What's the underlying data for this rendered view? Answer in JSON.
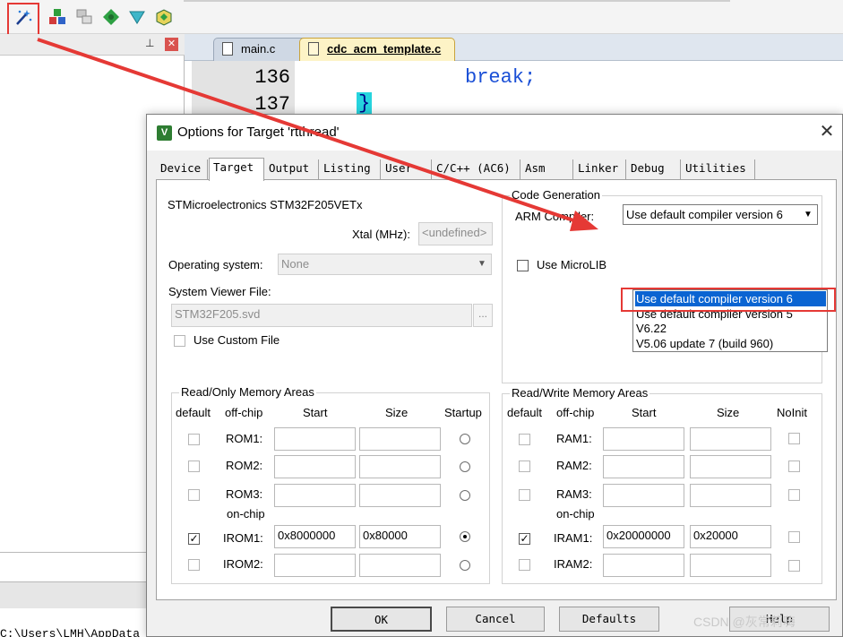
{
  "ide": {
    "editor_tabs": [
      {
        "label": "main.c",
        "active": false
      },
      {
        "label": "cdc_acm_template.c",
        "active": true
      }
    ],
    "line_numbers": [
      "136",
      "137"
    ],
    "code_line_136": "break;",
    "code_line_137": "}",
    "bottom_path": "C:\\Users\\LMH\\AppData"
  },
  "dialog": {
    "title": "Options for Target 'rtthread'",
    "tabs": [
      "Device",
      "Target",
      "Output",
      "Listing",
      "User",
      "C/C++ (AC6)",
      "Asm",
      "Linker",
      "Debug",
      "Utilities"
    ],
    "active_tab": "Target",
    "device_name": "STMicroelectronics STM32F205VETx",
    "xtal_label": "Xtal (MHz):",
    "xtal_value": "<undefined>",
    "os_label": "Operating system:",
    "os_value": "None",
    "svd_label": "System Viewer File:",
    "svd_value": "STM32F205.svd",
    "svd_browse": "...",
    "use_custom_file": "Use Custom File",
    "code_generation": {
      "title": "Code Generation",
      "arm_compiler_label": "ARM Compiler:",
      "arm_compiler_value": "Use default compiler version 6",
      "use_microlib": "Use MicroLIB",
      "options": [
        "Use default compiler version 6",
        "Use default compiler version 5",
        "V6.22",
        "V5.06 update 7 (build 960)"
      ],
      "selected_index": 0
    },
    "ro_memory": {
      "title": "Read/Only Memory Areas",
      "headers": {
        "default": "default",
        "offchip": "off-chip",
        "start": "Start",
        "size": "Size",
        "extra": "Startup"
      },
      "offchip_rows": [
        {
          "label": "ROM1:",
          "start": "",
          "size": "",
          "default_checked": false,
          "startup_selected": false
        },
        {
          "label": "ROM2:",
          "start": "",
          "size": "",
          "default_checked": false,
          "startup_selected": false
        },
        {
          "label": "ROM3:",
          "start": "",
          "size": "",
          "default_checked": false,
          "startup_selected": false
        }
      ],
      "onchip_label": "on-chip",
      "onchip_rows": [
        {
          "label": "IROM1:",
          "start": "0x8000000",
          "size": "0x80000",
          "default_checked": true,
          "startup_selected": true
        },
        {
          "label": "IROM2:",
          "start": "",
          "size": "",
          "default_checked": false,
          "startup_selected": false
        }
      ]
    },
    "rw_memory": {
      "title": "Read/Write Memory Areas",
      "headers": {
        "default": "default",
        "offchip": "off-chip",
        "start": "Start",
        "size": "Size",
        "extra": "NoInit"
      },
      "offchip_rows": [
        {
          "label": "RAM1:",
          "start": "",
          "size": "",
          "default_checked": false,
          "noinit": false
        },
        {
          "label": "RAM2:",
          "start": "",
          "size": "",
          "default_checked": false,
          "noinit": false
        },
        {
          "label": "RAM3:",
          "start": "",
          "size": "",
          "default_checked": false,
          "noinit": false
        }
      ],
      "onchip_label": "on-chip",
      "onchip_rows": [
        {
          "label": "IRAM1:",
          "start": "0x20000000",
          "size": "0x20000",
          "default_checked": true,
          "noinit": false
        },
        {
          "label": "IRAM2:",
          "start": "",
          "size": "",
          "default_checked": false,
          "noinit": false
        }
      ]
    },
    "buttons": {
      "ok": "OK",
      "cancel": "Cancel",
      "defaults": "Defaults",
      "help": "Help"
    }
  },
  "watermark": "CSDN @灰常莉嗨",
  "colors": {
    "annotation_red": "#e53935",
    "selection_blue": "#0a64d2",
    "keyword_blue": "#1a4fd6"
  }
}
